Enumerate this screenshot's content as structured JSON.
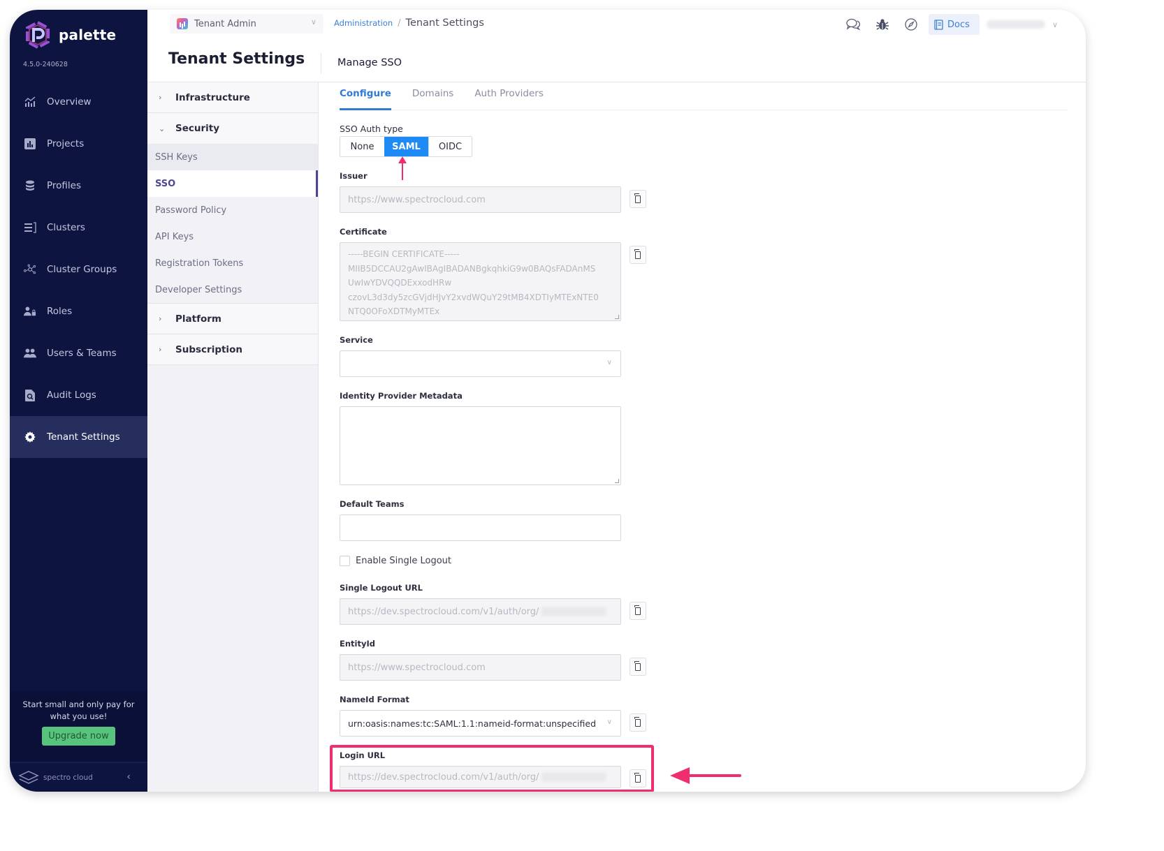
{
  "app": {
    "name": "palette",
    "version": "4.5.0-240628"
  },
  "sidebar": {
    "items": [
      {
        "label": "Overview",
        "icon": "chart-icon"
      },
      {
        "label": "Projects",
        "icon": "bar-chart-box-icon"
      },
      {
        "label": "Profiles",
        "icon": "database-stack-icon"
      },
      {
        "label": "Clusters",
        "icon": "list-rack-icon"
      },
      {
        "label": "Cluster Groups",
        "icon": "network-nodes-icon"
      },
      {
        "label": "Roles",
        "icon": "user-lock-icon"
      },
      {
        "label": "Users & Teams",
        "icon": "users-icon"
      },
      {
        "label": "Audit Logs",
        "icon": "file-search-icon"
      },
      {
        "label": "Tenant Settings",
        "icon": "gear-icon",
        "active": true
      }
    ],
    "promo_text": "Start small and only pay for what you use!",
    "upgrade_label": "Upgrade now",
    "brand_text": "spectro cloud",
    "collapse_icon": "chevron-left-icon"
  },
  "topbar": {
    "tenant_selector": "Tenant Admin",
    "breadcrumb": {
      "parent": "Administration",
      "separator": "/",
      "current": "Tenant Settings"
    },
    "icons": [
      "chat-icon",
      "bug-icon",
      "compass-icon"
    ],
    "docs_label": "Docs"
  },
  "page": {
    "title": "Tenant Settings",
    "section_title": "Manage SSO"
  },
  "settings_menu": {
    "groups": [
      {
        "label": "Infrastructure",
        "expanded": false
      },
      {
        "label": "Security",
        "expanded": true,
        "items": [
          "SSH Keys",
          "SSO",
          "Password Policy",
          "API Keys",
          "Registration Tokens",
          "Developer Settings"
        ],
        "active_item": "SSO"
      },
      {
        "label": "Platform",
        "expanded": false
      },
      {
        "label": "Subscription",
        "expanded": false
      }
    ]
  },
  "tabs": [
    {
      "label": "Configure",
      "active": true
    },
    {
      "label": "Domains"
    },
    {
      "label": "Auth Providers"
    }
  ],
  "form": {
    "auth_type": {
      "label": "SSO Auth type",
      "options": [
        "None",
        "SAML",
        "OIDC"
      ],
      "selected": "SAML"
    },
    "issuer": {
      "label": "Issuer",
      "placeholder": "https://www.spectrocloud.com"
    },
    "certificate": {
      "label": "Certificate",
      "placeholder": "-----BEGIN CERTIFICATE-----\nMIIB5DCCAU2gAwIBAgIBADANBgkqhkiG9w0BAQsFADAnMS\nUwIwYDVQQDExxodHRw\nczovL3d3dy5zcGVjdHJvY2xvdWQuY29tMB4XDTIyMTExNTE0\nNTQ0OFoXDTMyMTEx"
    },
    "service": {
      "label": "Service",
      "value": ""
    },
    "idp_metadata": {
      "label": "Identity Provider Metadata",
      "value": ""
    },
    "default_teams": {
      "label": "Default Teams",
      "value": ""
    },
    "single_logout": {
      "label": "Enable Single Logout",
      "checked": false
    },
    "single_logout_url": {
      "label": "Single Logout URL",
      "value": "https://dev.spectrocloud.com/v1/auth/org/"
    },
    "entity_id": {
      "label": "EntityId",
      "placeholder": "https://www.spectrocloud.com"
    },
    "nameid_format": {
      "label": "NameId Format",
      "value": "urn:oasis:names:tc:SAML:1.1:nameid-format:unspecified"
    },
    "login_url": {
      "label": "Login URL",
      "value": "https://dev.spectrocloud.com/v1/auth/org/"
    }
  },
  "annotations": {
    "color": "#ef2d6f"
  }
}
